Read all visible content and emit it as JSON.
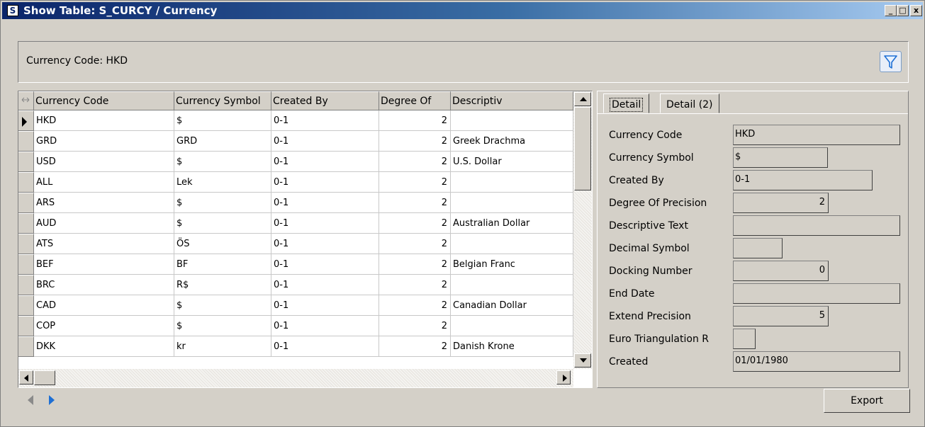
{
  "window": {
    "title": "Show Table: S_CURCY / Currency",
    "app_icon_letter": "S",
    "minimize_glyph": "_",
    "maximize_glyph": "□",
    "close_glyph": "x"
  },
  "header": {
    "label": "Currency Code: HKD",
    "filter_icon": "filter-funnel-icon"
  },
  "grid": {
    "columns": [
      "Currency Code",
      "Currency Symbol",
      "Created By",
      "Degree Of",
      "Descriptiv"
    ],
    "rows": [
      {
        "code": "HKD",
        "symbol": "$",
        "created_by": "0-1",
        "degree": "2",
        "desc": "",
        "current": true
      },
      {
        "code": "GRD",
        "symbol": "GRD",
        "created_by": "0-1",
        "degree": "2",
        "desc": "Greek Drachma"
      },
      {
        "code": "USD",
        "symbol": "$",
        "created_by": "0-1",
        "degree": "2",
        "desc": "U.S. Dollar"
      },
      {
        "code": "ALL",
        "symbol": "Lek",
        "created_by": "0-1",
        "degree": "2",
        "desc": ""
      },
      {
        "code": "ARS",
        "symbol": "$",
        "created_by": "0-1",
        "degree": "2",
        "desc": ""
      },
      {
        "code": "AUD",
        "symbol": "$",
        "created_by": "0-1",
        "degree": "2",
        "desc": "Australian Dollar"
      },
      {
        "code": "ATS",
        "symbol": "ÖS",
        "created_by": "0-1",
        "degree": "2",
        "desc": ""
      },
      {
        "code": "BEF",
        "symbol": "BF",
        "created_by": "0-1",
        "degree": "2",
        "desc": "Belgian Franc"
      },
      {
        "code": "BRC",
        "symbol": "R$",
        "created_by": "0-1",
        "degree": "2",
        "desc": ""
      },
      {
        "code": "CAD",
        "symbol": "$",
        "created_by": "0-1",
        "degree": "2",
        "desc": "Canadian Dollar"
      },
      {
        "code": "COP",
        "symbol": "$",
        "created_by": "0-1",
        "degree": "2",
        "desc": ""
      },
      {
        "code": "DKK",
        "symbol": "kr",
        "created_by": "0-1",
        "degree": "2",
        "desc": "Danish Krone"
      }
    ]
  },
  "detail": {
    "tabs": [
      "Detail",
      "Detail (2)"
    ],
    "fields": [
      {
        "label": "Currency Code",
        "value": "HKD"
      },
      {
        "label": "Currency Symbol",
        "value": "$"
      },
      {
        "label": "Created By",
        "value": "0-1"
      },
      {
        "label": "Degree Of Precision",
        "value": "2"
      },
      {
        "label": "Descriptive Text",
        "value": ""
      },
      {
        "label": "Decimal Symbol",
        "value": ""
      },
      {
        "label": "Docking Number",
        "value": "0"
      },
      {
        "label": "End Date",
        "value": ""
      },
      {
        "label": "Extend Precision",
        "value": "5"
      },
      {
        "label": "Euro Triangulation R",
        "value": ""
      },
      {
        "label": "Created",
        "value": "01/01/1980"
      }
    ]
  },
  "export_label": "Export",
  "colors": {
    "titlebar_start": "#0a246a",
    "titlebar_end": "#a6caf0",
    "face": "#d4d0c8",
    "nav_next": "#1e6fd4"
  }
}
